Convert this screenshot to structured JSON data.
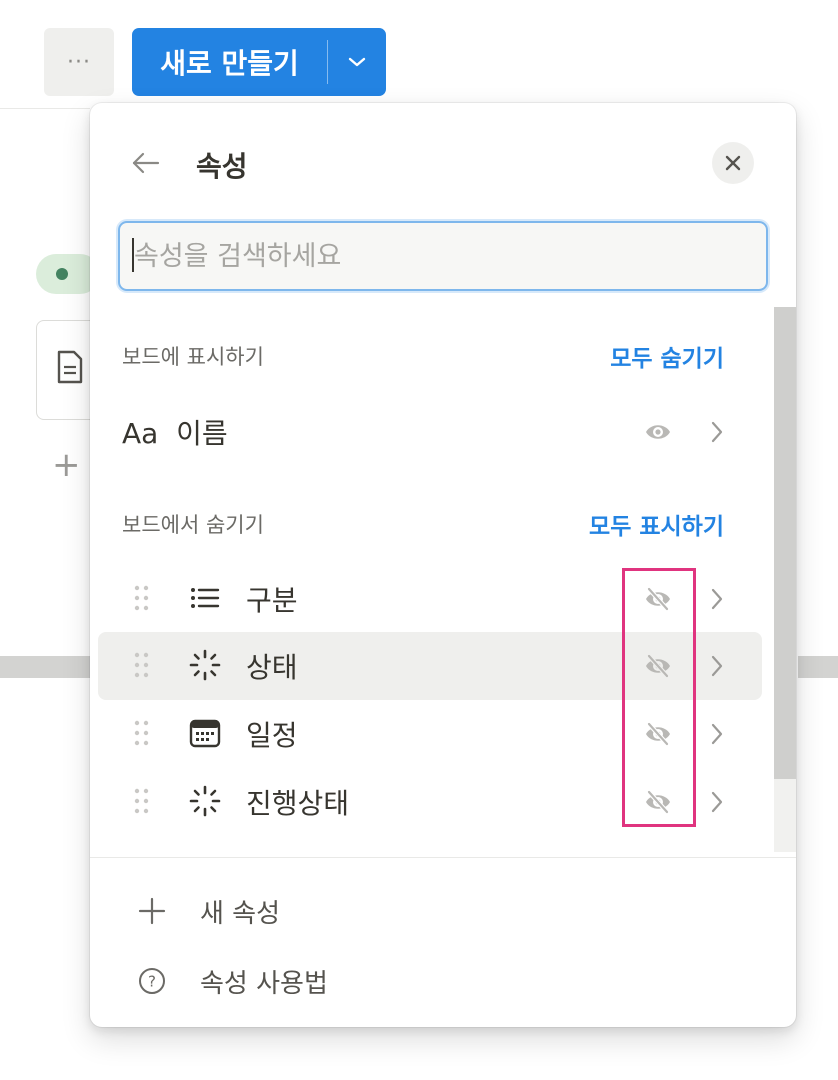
{
  "toolbar": {
    "more_label": "···",
    "new_button_label": "새로 만들기",
    "primary_color": "#2383e2"
  },
  "popover": {
    "title": "속성",
    "search": {
      "placeholder": "속성을 검색하세요",
      "value": ""
    },
    "shown_section": {
      "label": "보드에 표시하기",
      "action": "모두 숨기기",
      "items": [
        {
          "name": "이름",
          "type_label": "Aa",
          "visible": true
        }
      ]
    },
    "hidden_section": {
      "label": "보드에서 숨기기",
      "action": "모두 표시하기",
      "items": [
        {
          "name": "구분",
          "icon": "list-icon",
          "visible": false
        },
        {
          "name": "상태",
          "icon": "status-icon",
          "visible": false,
          "hovered": true
        },
        {
          "name": "일정",
          "icon": "calendar-icon",
          "visible": false
        },
        {
          "name": "진행상태",
          "icon": "status-icon",
          "visible": false
        }
      ]
    },
    "footer": {
      "new_property": "새 속성",
      "help": "속성 사용법"
    },
    "highlight_color": "#e0347f"
  }
}
